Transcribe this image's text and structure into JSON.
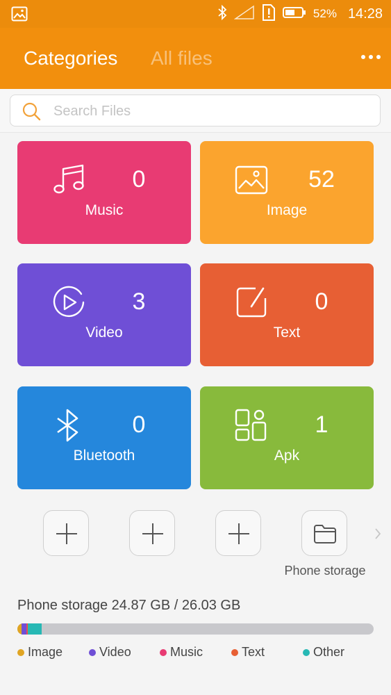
{
  "status_bar": {
    "battery_percent": "52%",
    "time": "14:28"
  },
  "header": {
    "tab_active": "Categories",
    "tab_inactive": "All files"
  },
  "search": {
    "placeholder": "Search Files"
  },
  "tiles": [
    {
      "label": "Music",
      "count": "0",
      "color": "#e83b73",
      "icon": "music-note-icon"
    },
    {
      "label": "Image",
      "count": "52",
      "color": "#fba42e",
      "icon": "image-icon"
    },
    {
      "label": "Video",
      "count": "3",
      "color": "#6f4fd6",
      "icon": "play-circle-icon"
    },
    {
      "label": "Text",
      "count": "0",
      "color": "#e75f34",
      "icon": "edit-note-icon"
    },
    {
      "label": "Bluetooth",
      "count": "0",
      "color": "#2587dc",
      "icon": "bluetooth-icon"
    },
    {
      "label": "Apk",
      "count": "1",
      "color": "#88ba3c",
      "icon": "apps-grid-icon"
    }
  ],
  "shortcuts": {
    "phone_storage_label": "Phone storage"
  },
  "storage": {
    "summary": "Phone storage 24.87 GB / 26.03 GB",
    "used_fraction": 0.955,
    "breakdown_fraction": {
      "image": 0.012,
      "video": 0.014,
      "music": 0.002,
      "text": 0.001,
      "other": 0.04
    }
  },
  "legend": [
    {
      "label": "Image",
      "color": "#e0a523"
    },
    {
      "label": "Video",
      "color": "#6f4fd6"
    },
    {
      "label": "Music",
      "color": "#e83b73"
    },
    {
      "label": "Text",
      "color": "#e75f34"
    },
    {
      "label": "Other",
      "color": "#27b8b4"
    }
  ]
}
